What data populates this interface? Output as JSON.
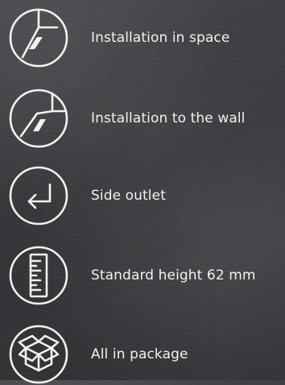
{
  "features": [
    {
      "icon": "installation-in-space-icon",
      "label": "Installation in space"
    },
    {
      "icon": "installation-to-wall-icon",
      "label": "Installation to the wall"
    },
    {
      "icon": "side-outlet-arrow-icon",
      "label": "Side outlet"
    },
    {
      "icon": "ruler-icon",
      "label": "Standard height 62 mm"
    },
    {
      "icon": "package-box-icon",
      "label": "All in package"
    }
  ],
  "colors": {
    "foreground": "#f2f2f2",
    "background": "#3b3c40"
  }
}
